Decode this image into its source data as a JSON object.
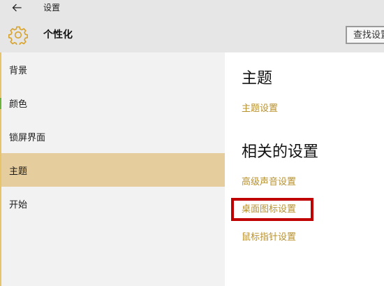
{
  "window": {
    "title": "设置",
    "back_icon": "back-arrow-icon"
  },
  "header": {
    "title": "个性化",
    "icon": "gear-icon",
    "search": {
      "value": "",
      "placeholder": "查找设置"
    }
  },
  "sidebar": {
    "items": [
      {
        "label": "背景",
        "selected": false
      },
      {
        "label": "颜色",
        "selected": false
      },
      {
        "label": "锁屏界面",
        "selected": false
      },
      {
        "label": "主题",
        "selected": true
      },
      {
        "label": "开始",
        "selected": false
      }
    ]
  },
  "content": {
    "section1": {
      "heading": "主题",
      "links": [
        "主题设置"
      ]
    },
    "section2": {
      "heading": "相关的设置",
      "links": [
        "高级声音设置",
        "桌面图标设置",
        "鼠标指针设置"
      ]
    }
  },
  "colors": {
    "accent": "#b8912f",
    "selected_item_bg": "#e6cd9d",
    "header_bg": "#e6e6e6",
    "sidebar_bg": "#f2f2f2",
    "highlight_box": "#c00000"
  }
}
